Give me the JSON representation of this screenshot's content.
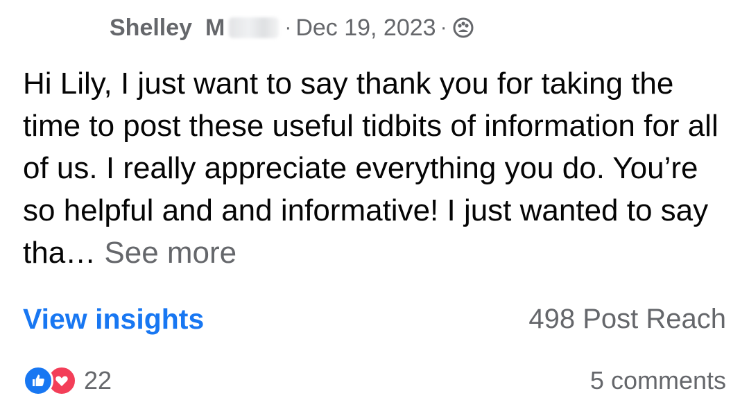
{
  "post": {
    "author_first": "Shelley",
    "author_last_initial": "M",
    "date": "Dec 19, 2023",
    "separator": "·",
    "privacy_icon": "group-icon",
    "body": "Hi Lily, I just want to say thank you for taking the time to post these useful tidbits of information for all of us. I really appreciate everything you do. You’re so helpful and and informative! I just wanted to say tha… ",
    "see_more": "See more"
  },
  "insights": {
    "link_label": "View insights",
    "reach_label": "498 Post Reach"
  },
  "engagement": {
    "reaction_icons": [
      "like-icon",
      "love-icon"
    ],
    "reaction_count": "22",
    "comments_label": "5 comments"
  },
  "colors": {
    "link_blue": "#1877f2",
    "secondary_text": "#65676b",
    "primary_text": "#050505",
    "like_blue": "#1877f2",
    "love_red": "#f33e58"
  }
}
